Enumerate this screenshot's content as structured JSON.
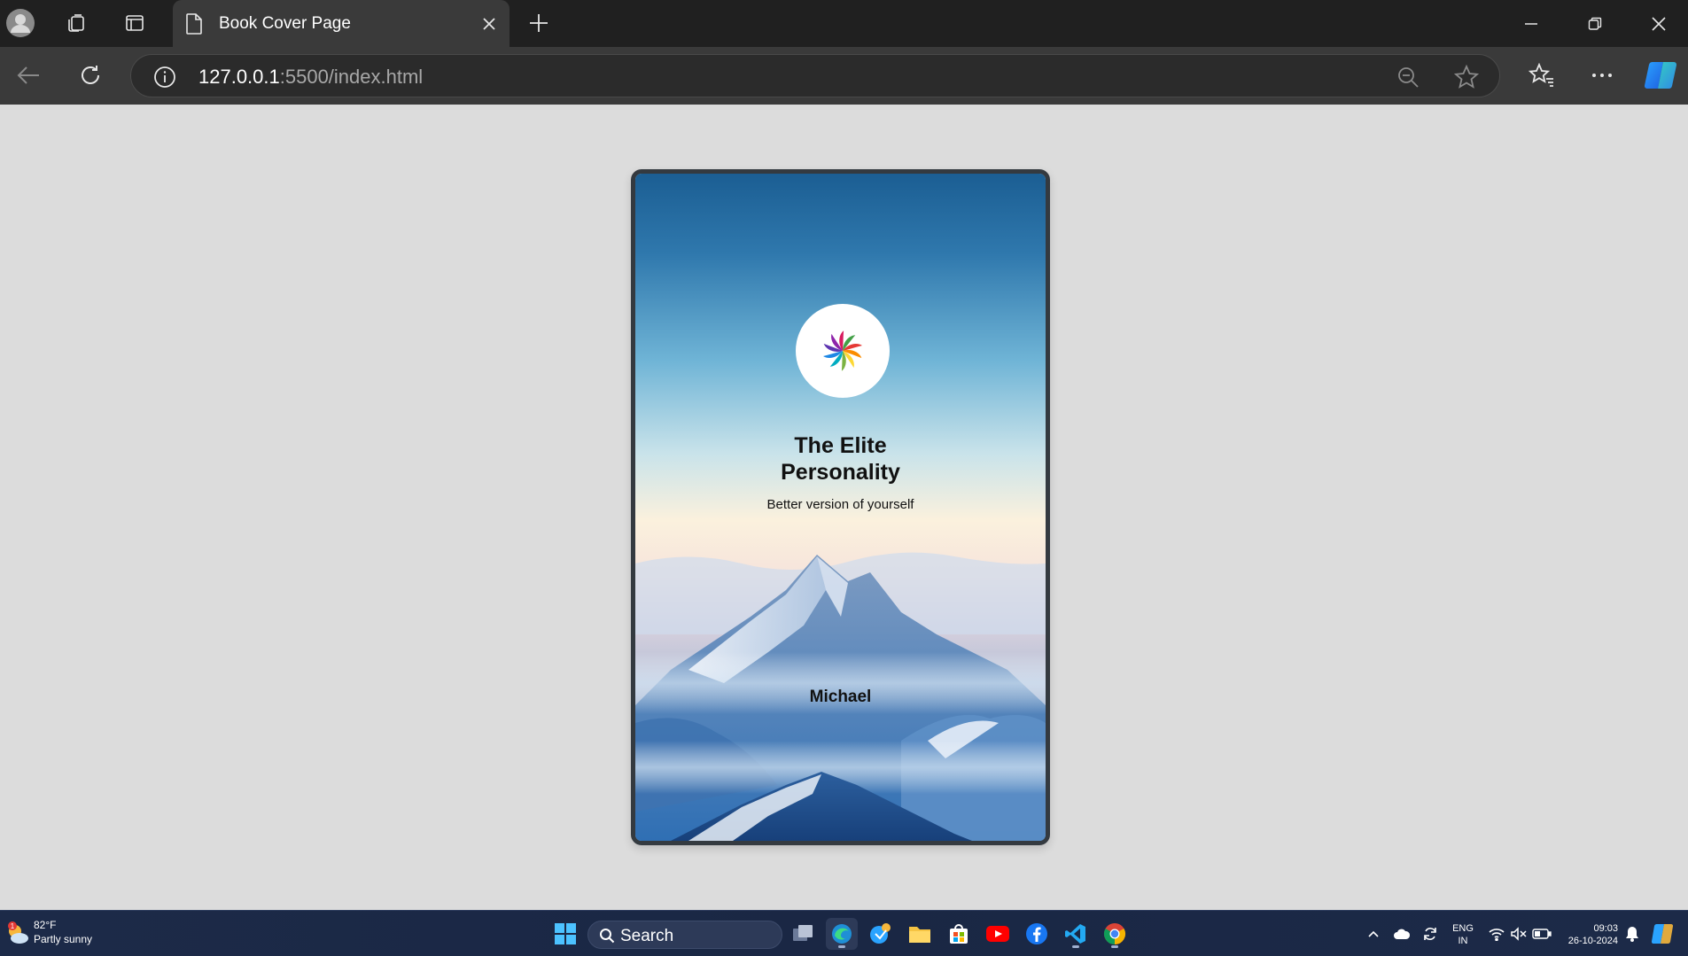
{
  "browser": {
    "tab": {
      "title": "Book Cover Page",
      "icon": "document-icon"
    },
    "address": {
      "host": "127.0.0.1",
      "rest": ":5500/index.html"
    },
    "icons": {
      "profile": "profile-icon",
      "workspaces": "workspaces-icon",
      "tab_actions": "tab-actions-icon",
      "close_tab": "close-icon",
      "new_tab": "plus-icon",
      "minimize": "minimize-icon",
      "restore": "restore-icon",
      "close_window": "close-icon",
      "back": "back-arrow-icon",
      "refresh": "refresh-icon",
      "site_info": "info-icon",
      "zoom": "zoom-out-icon",
      "favorite": "star-icon",
      "favorites": "favorites-icon",
      "more": "more-icon",
      "copilot": "copilot-icon"
    }
  },
  "book": {
    "title_line1": "The Elite",
    "title_line2": "Personality",
    "subtitle": "Better version of yourself",
    "author": "Michael",
    "logo_icon": "pinwheel-logo-icon"
  },
  "taskbar": {
    "weather": {
      "temp": "82°F",
      "desc": "Partly sunny",
      "badge": "1"
    },
    "search_label": "Search",
    "tray": {
      "lang_line1": "ENG",
      "lang_line2": "IN",
      "time": "09:03",
      "date": "26-10-2024"
    }
  },
  "colors": {
    "page_background": "#dcdcdc",
    "book_border": "#343a40",
    "tab_active": "#3a3a3a",
    "titlebar": "#202020"
  }
}
